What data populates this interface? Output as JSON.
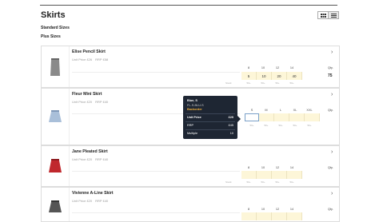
{
  "page": {
    "title": "Skirts"
  },
  "filters": [
    "Standard Sizes",
    "Plus Sizes"
  ],
  "products": [
    {
      "name": "Elise Pencil Skirt",
      "unit_price": "Unit Price £26",
      "rrp": "RRP £58",
      "sizes": [
        "8",
        "10",
        "12",
        "14"
      ],
      "qty_values": [
        "5",
        "10",
        "20",
        "40"
      ],
      "qty_label": "Qty.",
      "qty_total": "75",
      "stock_label": "Stock",
      "stock": [
        "50+",
        "50+",
        "50+",
        "50+"
      ],
      "color": "#8a8a8a"
    },
    {
      "name": "Fleur Mini Skirt",
      "unit_price": "Unit Price £20",
      "rrp": "RRP £40",
      "sizes": [
        "S",
        "M",
        "L",
        "XL",
        "XXL"
      ],
      "qty_values": [
        "",
        "",
        "",
        "",
        ""
      ],
      "qty_label": "Qty.",
      "qty_total": "",
      "stock_label": "Stock",
      "stock": [
        "50+",
        "50+",
        "50+",
        "50+",
        "50+"
      ],
      "color": "#a9bfd9"
    },
    {
      "name": "Jane Pleated Skirt",
      "unit_price": "Unit Price £20",
      "rrp": "RRP £40",
      "sizes": [
        "8",
        "10",
        "12",
        "14"
      ],
      "qty_values": [
        "",
        "",
        "",
        ""
      ],
      "qty_label": "Qty.",
      "qty_total": "",
      "stock_label": "Stock",
      "stock": [
        "50+",
        "50+",
        "50+",
        "50+"
      ],
      "color": "#c0282d"
    },
    {
      "name": "Vivienne A-Line Skirt",
      "unit_price": "Unit Price £20",
      "rrp": "RRP £40",
      "sizes": [
        "8",
        "10",
        "12",
        "14"
      ],
      "qty_values": [
        "",
        "",
        "",
        ""
      ],
      "qty_label": "Qty.",
      "qty_total": "",
      "stock_label": "",
      "stock": [],
      "color": "#555555"
    }
  ],
  "tooltip": {
    "variant": "Blue, S",
    "sku": "FL-S-BLU-S",
    "status": "Backorder",
    "unit_price_label": "Unit Price",
    "unit_price_value": "£20",
    "rrp_label": "RRP",
    "rrp_value": "£45",
    "multiple_label": "Multiple",
    "multiple_value": "10"
  }
}
